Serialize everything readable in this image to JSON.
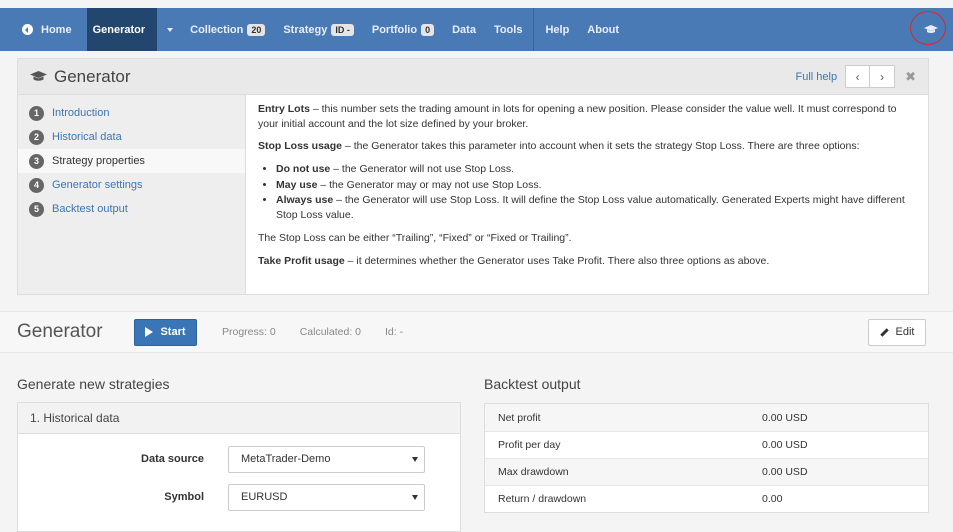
{
  "nav": {
    "home": "Home",
    "generator": "Generator",
    "collection": "Collection",
    "collection_count": "20",
    "strategy": "Strategy",
    "strategy_badge": "ID -",
    "portfolio": "Portfolio",
    "portfolio_count": "0",
    "data": "Data",
    "tools": "Tools",
    "help": "Help",
    "about": "About",
    "right_icon": "graduation-cap-icon",
    "accent": "#4a7ab5"
  },
  "help_panel": {
    "title": "Generator",
    "title_icon": "graduation-cap-icon",
    "full_help": "Full help",
    "prev": "‹",
    "next": "›",
    "close": "✖",
    "steps": [
      {
        "num": "1",
        "label": "Introduction"
      },
      {
        "num": "2",
        "label": "Historical data"
      },
      {
        "num": "3",
        "label": "Strategy properties"
      },
      {
        "num": "4",
        "label": "Generator settings"
      },
      {
        "num": "5",
        "label": "Backtest output"
      }
    ],
    "content": {
      "p1_bold": "Entry Lots",
      "p1_text": " – this number sets the trading amount in lots for opening a new position. Please consider the value well. It must correspond to your initial account and the lot size defined by your broker.",
      "p2_bold": "Stop Loss usage",
      "p2_text": " – the Generator takes this parameter into account when it sets the strategy Stop Loss. There are three options:",
      "opt1_bold": "Do not use",
      "opt1_text": " – the Generator will not use Stop Loss.",
      "opt2_bold": "May use",
      "opt2_text": " – the Generator may or may not use Stop Loss.",
      "opt3_bold": "Always use",
      "opt3_text": " – the Generator will use Stop Loss. It will define the Stop Loss value automatically. Generated Experts might have different Stop Loss value.",
      "p3": "The Stop Loss can be either “Trailing”, “Fixed” or “Fixed or Trailing”.",
      "p4_bold": "Take Profit usage",
      "p4_text": " – it determines whether the Generator uses Take Profit. There also three options as above."
    }
  },
  "generator_bar": {
    "title": "Generator",
    "start": "Start",
    "progress": "Progress: 0",
    "calculated": "Calculated: 0",
    "id": "Id: -",
    "edit": "Edit"
  },
  "generate": {
    "title": "Generate new strategies",
    "section": "1. Historical data",
    "data_source_label": "Data source",
    "data_source_value": "MetaTrader-Demo",
    "symbol_label": "Symbol",
    "symbol_value": "EURUSD"
  },
  "backtest": {
    "title": "Backtest output",
    "rows": [
      {
        "k": "Net profit",
        "v": "0.00 USD"
      },
      {
        "k": "Profit per day",
        "v": "0.00 USD"
      },
      {
        "k": "Max drawdown",
        "v": "0.00 USD"
      },
      {
        "k": "Return / drawdown",
        "v": "0.00"
      }
    ]
  }
}
